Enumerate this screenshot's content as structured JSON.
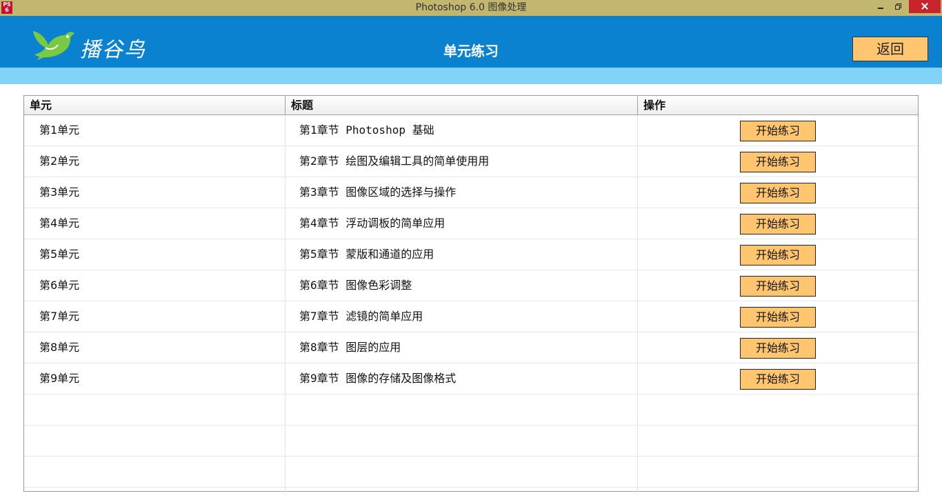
{
  "window": {
    "title": "Photoshop 6.0 图像处理",
    "icon_text_top": "PS",
    "icon_text_bottom": "6"
  },
  "header": {
    "logo_text": "播谷鸟",
    "title": "单元练习",
    "back_label": "返回"
  },
  "colors": {
    "titlebar": "#c3b76f",
    "header": "#0b82d0",
    "subbar": "#81d4f8",
    "button": "#ffc56f",
    "logo_green": "#7ac943"
  },
  "table": {
    "columns": [
      "单元",
      "标题",
      "操作"
    ],
    "rows": [
      {
        "unit": "第1单元",
        "title": "第1章节 Photoshop 基础",
        "action": "开始练习"
      },
      {
        "unit": "第2单元",
        "title": "第2章节 绘图及编辑工具的简单使用用",
        "action": "开始练习"
      },
      {
        "unit": "第3单元",
        "title": "第3章节 图像区域的选择与操作",
        "action": "开始练习"
      },
      {
        "unit": "第4单元",
        "title": "第4章节 浮动调板的简单应用",
        "action": "开始练习"
      },
      {
        "unit": "第5单元",
        "title": "第5章节 蒙版和通道的应用",
        "action": "开始练习"
      },
      {
        "unit": "第6单元",
        "title": "第6章节 图像色彩调整",
        "action": "开始练习"
      },
      {
        "unit": "第7单元",
        "title": "第7章节 滤镜的简单应用",
        "action": "开始练习"
      },
      {
        "unit": "第8单元",
        "title": "第8章节 图层的应用",
        "action": "开始练习"
      },
      {
        "unit": "第9单元",
        "title": "第9章节 图像的存储及图像格式",
        "action": "开始练习"
      }
    ],
    "empty_rows": 3
  }
}
